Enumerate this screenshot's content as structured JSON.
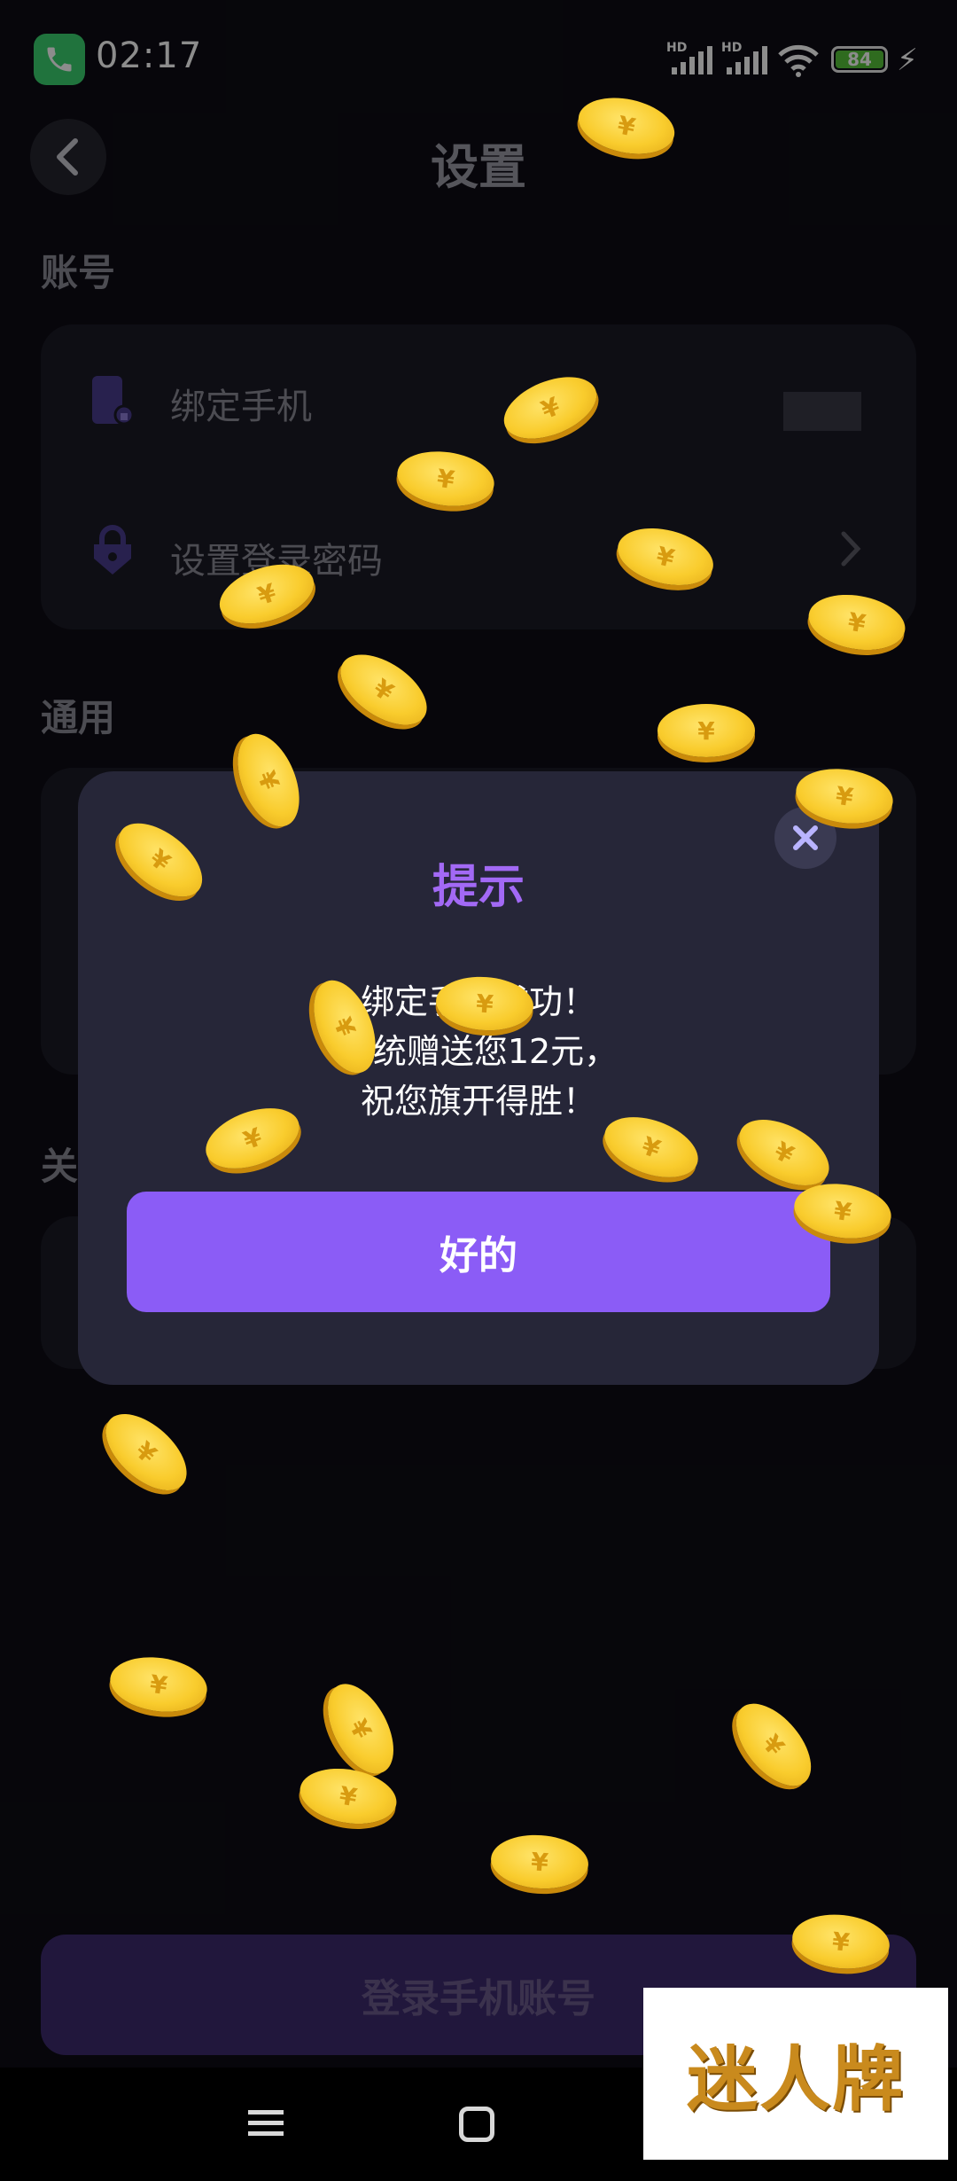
{
  "status_bar": {
    "time": "02:17",
    "signal_1_label": "HD",
    "signal_2_label": "HD",
    "battery_level": "84",
    "charging_icon": "bolt-icon"
  },
  "header": {
    "title": "设置",
    "back_icon": "chevron-left-icon"
  },
  "sections": {
    "account": {
      "title": "账号",
      "rows": [
        {
          "label": "绑定手机",
          "icon": "phone-lock-icon",
          "value": ""
        },
        {
          "label": "设置登录密码",
          "icon": "lock-icon",
          "chevron": "chevron-right-icon"
        }
      ]
    },
    "general": {
      "title": "通用"
    },
    "about": {
      "title": "关"
    }
  },
  "bottom": {
    "login_button": "登录手机账号"
  },
  "dialog": {
    "title": "提示",
    "message_line1": "绑定手机成功！",
    "message_line2": "系统赠送您12元，",
    "message_line3": "祝您旗开得胜！",
    "ok_button": "好的",
    "close_icon": "close-icon"
  },
  "nav": {
    "menu_icon": "menu-icon",
    "home_icon": "home-square-icon"
  },
  "watermark": {
    "text": "迷人牌"
  },
  "coin_symbol": "¥",
  "colors": {
    "background": "#0d0c14",
    "accent": "#8b5cf6",
    "dialog_bg": "#262638",
    "title_purple": "#a269f5",
    "coin_gold": "#f9cc2d"
  }
}
